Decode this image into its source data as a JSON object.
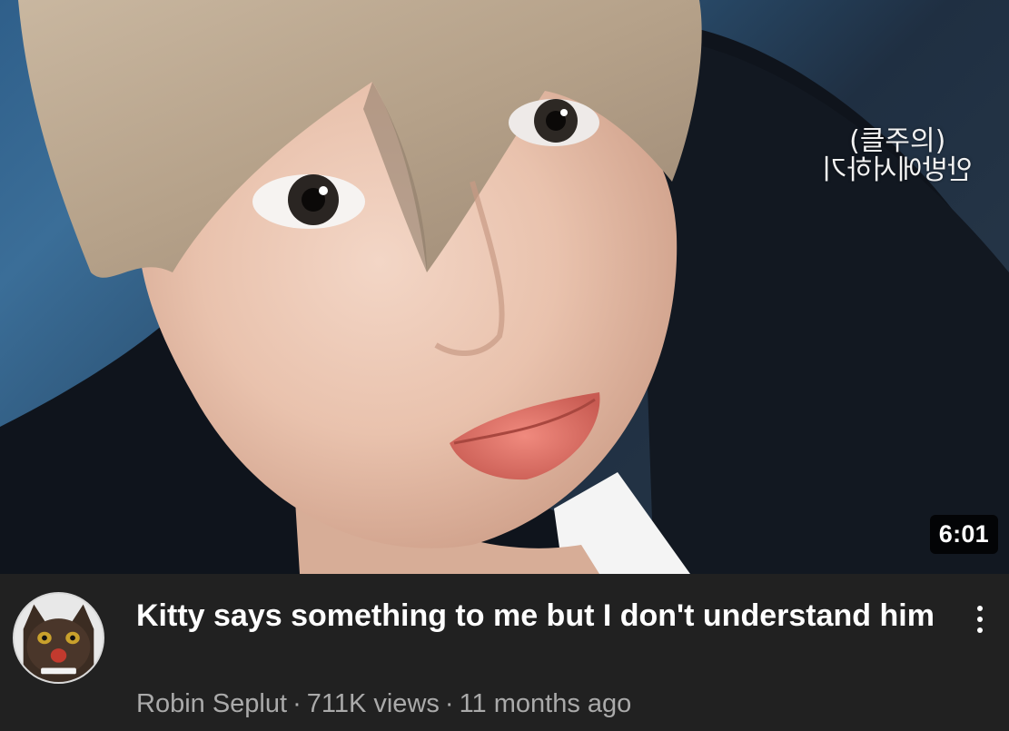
{
  "video": {
    "thumbnail": {
      "subject": "close-up face thumbnail",
      "watermark_line1": "(클주의)",
      "watermark_line2": "안방에서하기"
    },
    "duration": "6:01",
    "title": "Kitty says something to me but I don't understand him",
    "channel": "Robin Seplut",
    "views": "711K views",
    "age": "11 months ago",
    "separator": "·"
  },
  "icons": {
    "menu": "more-vert-icon",
    "avatar": "cat-avatar"
  },
  "colors": {
    "background": "#212121",
    "title": "#ffffff",
    "meta": "#aaaaaa",
    "duration_bg": "#000000"
  }
}
